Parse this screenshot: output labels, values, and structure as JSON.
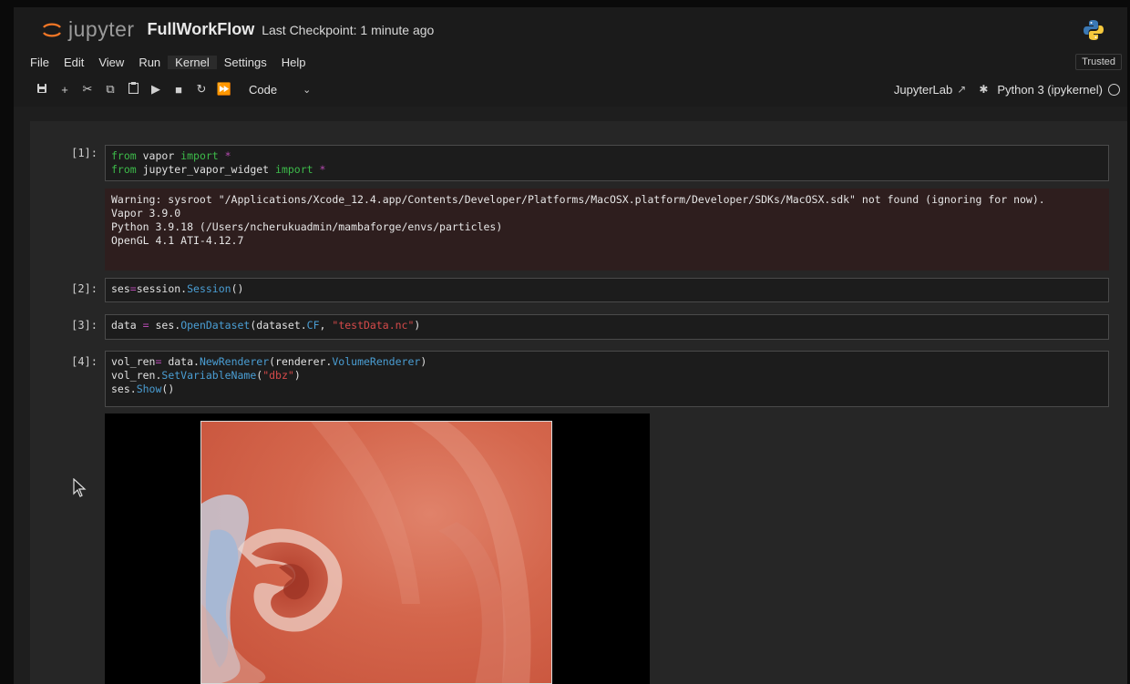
{
  "header": {
    "logo_text": "jupyter",
    "notebook_title": "FullWorkFlow",
    "checkpoint": "Last Checkpoint: 1 minute ago"
  },
  "menu": {
    "items": [
      "File",
      "Edit",
      "View",
      "Run",
      "Kernel",
      "Settings",
      "Help"
    ],
    "trusted": "Trusted"
  },
  "toolbar": {
    "cell_type": "Code",
    "jupyterlab_label": "JupyterLab",
    "kernel_name": "Python 3 (ipykernel)",
    "icons": [
      "save-icon",
      "add-cell-icon",
      "cut-icon",
      "copy-icon",
      "paste-icon",
      "run-icon",
      "stop-icon",
      "restart-icon",
      "run-all-icon"
    ]
  },
  "cells": [
    {
      "prompt": "[1]:",
      "lines": [
        "from vapor import *",
        "from jupyter_vapor_widget import *"
      ]
    },
    {
      "prompt": "[2]:",
      "lines": [
        "ses=session.Session()"
      ]
    },
    {
      "prompt": "[3]:",
      "lines": [
        "data = ses.OpenDataset(dataset.CF, \"testData.nc\")"
      ]
    },
    {
      "prompt": "[4]:",
      "lines": [
        "vol_ren= data.NewRenderer(renderer.VolumeRenderer)",
        "vol_ren.SetVariableName(\"dbz\")",
        "ses.Show()"
      ]
    }
  ],
  "output_1": {
    "text": "Warning: sysroot \"/Applications/Xcode_12.4.app/Contents/Developer/Platforms/MacOSX.platform/Developer/SDKs/MacOSX.sdk\" not found (ignoring for now).\nVapor 3.9.0\nPython 3.9.18 (/Users/ncherukuadmin/mambaforge/envs/particles)\nOpenGL 4.1 ATI-4.12.7"
  },
  "colors": {
    "keyword": "#3dbb4a",
    "function": "#4a9ed4",
    "string": "#d64a4a",
    "operator": "#b54ab0"
  }
}
